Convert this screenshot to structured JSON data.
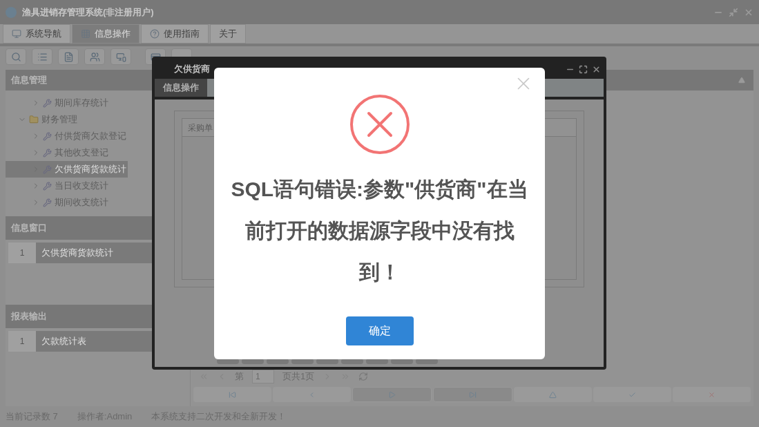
{
  "window": {
    "title": "渔具进销存管理系统(非注册用户)"
  },
  "tabs": [
    {
      "label": "系统导航",
      "selected": false
    },
    {
      "label": "信息操作",
      "selected": true
    },
    {
      "label": "使用指南",
      "selected": false
    },
    {
      "label": "关于",
      "selected": false
    }
  ],
  "sidebar": {
    "title": "信息管理",
    "tree": [
      {
        "label": "期间库存统计",
        "kind": "leaf",
        "selected": false
      },
      {
        "label": "财务管理",
        "kind": "folder",
        "expanded": true,
        "children": [
          {
            "label": "付供货商欠款登记",
            "kind": "leaf",
            "selected": false
          },
          {
            "label": "其他收支登记",
            "kind": "leaf",
            "selected": false
          },
          {
            "label": "欠供货商货款统计",
            "kind": "leaf",
            "selected": true
          },
          {
            "label": "当日收支统计",
            "kind": "leaf",
            "selected": false
          },
          {
            "label": "期间收支统计",
            "kind": "leaf",
            "selected": false
          }
        ]
      }
    ]
  },
  "info_window": {
    "title": "信息窗口",
    "items": [
      {
        "number": "1",
        "label": "欠供货商货款统计"
      }
    ]
  },
  "report_output": {
    "title": "报表输出",
    "items": [
      {
        "number": "1",
        "label": "欠款统计表"
      }
    ]
  },
  "pager": {
    "page_label": "第",
    "page": "1",
    "total": "页共1页"
  },
  "status_bar": [
    "当前记录数 7",
    "操作者:Admin",
    "本系统支持二次开发和全新开发！"
  ],
  "dialog": {
    "title": "欠供货商",
    "tabs": [
      {
        "label": "信息操作",
        "selected": true
      }
    ],
    "columns": [
      "采购单"
    ]
  },
  "alert": {
    "message": "SQL语句错误:参数\"供货商\"在当前打开的数据源字段中没有找到！",
    "button": "确定"
  }
}
